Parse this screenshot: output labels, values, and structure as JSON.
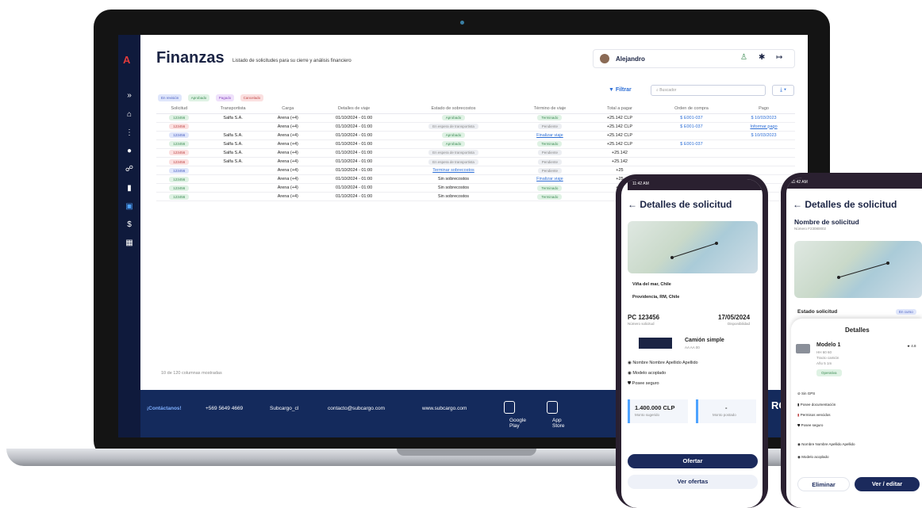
{
  "app": {
    "title": "Finanzas",
    "subtitle": "Listado de solicitudes para su cierre y análisis financiero",
    "user_name": "Alejandro",
    "logo": "A"
  },
  "sidebar_icons": [
    "chevrons-right-icon",
    "home-icon",
    "route-icon",
    "circle-icon",
    "people-icon",
    "document-icon",
    "calendar-icon",
    "dollar-icon",
    "dashboard-icon"
  ],
  "chips": [
    {
      "label": "En revisión",
      "color": "#dfe6fb",
      "text": "#4a5fc0"
    },
    {
      "label": "Aprobado",
      "color": "#dff2e4",
      "text": "#3e8d55"
    },
    {
      "label": "Pagado",
      "color": "#efe1fb",
      "text": "#8a4ac0"
    },
    {
      "label": "Cancelado",
      "color": "#fbe0e0",
      "text": "#c04848"
    }
  ],
  "toolbar": {
    "filter_label": "Filtrar",
    "search_placeholder": "Buscador"
  },
  "table": {
    "columns": [
      "Solicitud",
      "Transportista",
      "Carga",
      "Detalles de viaje",
      "Estado de sobrecostos",
      "Término de viaje",
      "Total a pagar",
      "Orden de compra",
      "Pago"
    ],
    "rows": [
      {
        "id": "123456",
        "idc": "p-green",
        "carrier": "Salfa S.A.",
        "cargo": "Arena (+4)",
        "trip": "01/10/2024 - 01:00",
        "sob": "Aprobado",
        "sobc": "p-green",
        "fin": "Terminado",
        "finc": "p-green",
        "total": "+25.142 CLP",
        "oc": "$ E001-037",
        "pay": "$ 10/03/2023"
      },
      {
        "id": "123456",
        "idc": "p-red",
        "carrier": "",
        "cargo": "Arena (+4)",
        "trip": "01/10/2024 - 01:00",
        "sob": "En espera de transportista",
        "sobc": "p-gray",
        "fin": "Pendiente",
        "finc": "p-gray",
        "total": "+25.142 CLP",
        "oc": "$ E001-037",
        "pay": "Informar pago"
      },
      {
        "id": "123456",
        "idc": "p-blue",
        "carrier": "Salfa S.A.",
        "cargo": "Arena (+4)",
        "trip": "01/10/2024 - 01:00",
        "sob": "Aprobado",
        "sobc": "p-green",
        "fin": "Finalizar viaje",
        "finc": "lnk",
        "total": "+25.142 CLP",
        "oc": "",
        "pay": "$ 10/03/2023"
      },
      {
        "id": "123456",
        "idc": "p-green",
        "carrier": "Salfa S.A.",
        "cargo": "Arena (+4)",
        "trip": "01/10/2024 - 01:00",
        "sob": "Aprobado",
        "sobc": "p-green",
        "fin": "Terminado",
        "finc": "p-green",
        "total": "+25.142 CLP",
        "oc": "$ E001-037",
        "pay": ""
      },
      {
        "id": "123456",
        "idc": "p-red",
        "carrier": "Salfa S.A.",
        "cargo": "Arena (+4)",
        "trip": "01/10/2024 - 01:00",
        "sob": "En espera de transportista",
        "sobc": "p-gray",
        "fin": "Pendiente",
        "finc": "p-gray",
        "total": "+25.142",
        "oc": "",
        "pay": ""
      },
      {
        "id": "123456",
        "idc": "p-red",
        "carrier": "Salfa S.A.",
        "cargo": "Arena (+4)",
        "trip": "01/10/2024 - 01:00",
        "sob": "En espera de transportista",
        "sobc": "p-gray",
        "fin": "Pendiente",
        "finc": "p-gray",
        "total": "+25.142",
        "oc": "",
        "pay": ""
      },
      {
        "id": "123456",
        "idc": "p-blue",
        "carrier": "",
        "cargo": "Arena (+4)",
        "trip": "01/10/2024 - 01:00",
        "sob": "Terminar sobrecostos",
        "sobc": "lnk",
        "fin": "Pendiente",
        "finc": "p-gray",
        "total": "+25",
        "oc": "",
        "pay": ""
      },
      {
        "id": "123456",
        "idc": "p-green",
        "carrier": "",
        "cargo": "Arena (+4)",
        "trip": "01/10/2024 - 01:00",
        "sob": "Sin sobrecostos",
        "sobc": "",
        "fin": "Finalizar viaje",
        "finc": "lnk",
        "total": "+25",
        "oc": "",
        "pay": ""
      },
      {
        "id": "123456",
        "idc": "p-green",
        "carrier": "",
        "cargo": "Arena (+4)",
        "trip": "01/10/2024 - 01:00",
        "sob": "Sin sobrecostos",
        "sobc": "",
        "fin": "Terminado",
        "finc": "p-green",
        "total": "+25",
        "oc": "",
        "pay": ""
      },
      {
        "id": "123456",
        "idc": "p-green",
        "carrier": "",
        "cargo": "Arena (+4)",
        "trip": "01/10/2024 - 01:00",
        "sob": "Sin sobrecostos",
        "sobc": "",
        "fin": "Terminado",
        "finc": "p-green",
        "total": "+25",
        "oc": "",
        "pay": ""
      }
    ],
    "footnote": "10 de 120 columnas mostradas"
  },
  "footer": {
    "contact": "¡Contáctanos!",
    "phone": "+569 5649 4669",
    "social": "Subcargo_cl",
    "email": "contacto@subcargo.com",
    "web": "www.subcargo.com",
    "google_play": "Google Play",
    "app_store": "App Store",
    "brand_fragment": "RC"
  },
  "phone1": {
    "time": "11:42 AM",
    "title": "Detalles de solicitud",
    "origin": "Viña del mar, Chile",
    "destination": "Providencia, RM, Chile",
    "code": "PC 123456",
    "code_label": "Número solicitud",
    "date": "17/05/2024",
    "date_label": "Disponibilidad",
    "truck": "Camión simple",
    "plate": "AA AA 00",
    "owner": "Nombre Nombre Apellido Apellido",
    "model": "Modelo acoplado",
    "insurance": "Posee seguro",
    "amount": "1.400.000 CLP",
    "amount_label": "Monto sugerido",
    "posted": "-",
    "posted_label": "Monto postado",
    "offer_button": "Ofertar",
    "view_offers": "Ver ofertas"
  },
  "phone2": {
    "time": "11:42 AM",
    "title": "Detalles de solicitud",
    "req_name": "Nombre de solicitud",
    "req_num": "Número F23080002",
    "estado": "Estado solicitud",
    "estado_badge": "En curso",
    "sheet_title": "Detalles",
    "model": "Modelo 1",
    "model_code": "HH 60 60",
    "model_type": "Tracto camión",
    "model_year": "Año 5 1m",
    "rating": "4.8",
    "status": "Operativa",
    "gps": "Sin GPS",
    "docs": "Posee documentación",
    "perms": "Permisos vencidos",
    "insurance": "Posee seguro",
    "owner": "Nombre Nombre Apellido Apellido",
    "coupled": "Modelo acoplado",
    "delete": "Eliminar",
    "edit": "Ver / editar"
  }
}
